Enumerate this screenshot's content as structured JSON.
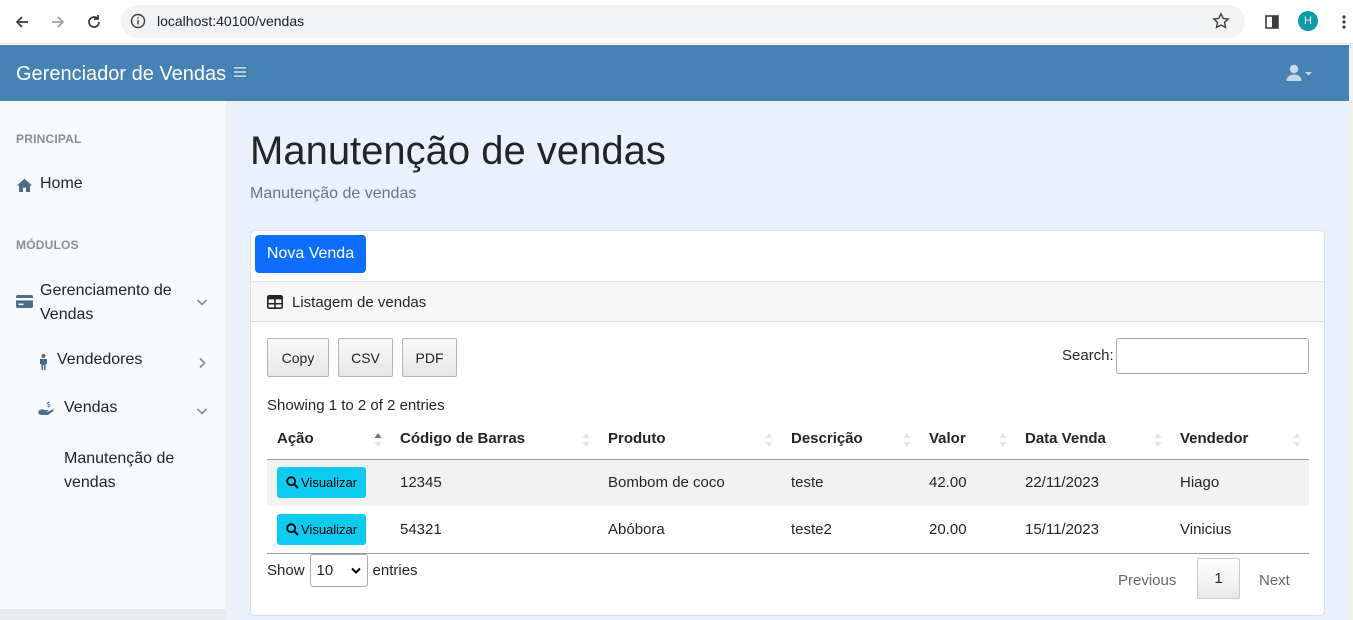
{
  "browser": {
    "url": "localhost:40100/vendas",
    "profile_initial": "H"
  },
  "app": {
    "brand": "Gerenciador de Vendas"
  },
  "sidebar": {
    "heading_principal": "PRINCIPAL",
    "home_label": "Home",
    "heading_modulos": "MÓDULOS",
    "gerenciamento_label_line1": "Gerenciamento de",
    "gerenciamento_label_line2": "Vendas",
    "vendedores_label": "Vendedores",
    "vendas_label": "Vendas",
    "manutencao_label_line1": "Manutenção de",
    "manutencao_label_line2": "vendas"
  },
  "page": {
    "title": "Manutenção de vendas",
    "subtitle": "Manutenção de vendas"
  },
  "card": {
    "new_button": "Nova Venda",
    "header": "Listagem de vendas",
    "buttons": [
      "Copy",
      "CSV",
      "PDF"
    ],
    "search_label": "Search:",
    "search_value": "",
    "info": "Showing 1 to 2 of 2 entries",
    "columns": [
      "Ação",
      "Código de Barras",
      "Produto",
      "Descrição",
      "Valor",
      "Data Venda",
      "Vendedor"
    ],
    "rows": [
      {
        "action": "Visualizar",
        "barcode": "12345",
        "product": "Bombom de coco",
        "description": "teste",
        "value": "42.00",
        "date": "22/11/2023",
        "seller": "Hiago"
      },
      {
        "action": "Visualizar",
        "barcode": "54321",
        "product": "Abóbora",
        "description": "teste2",
        "value": "20.00",
        "date": "15/11/2023",
        "seller": "Vinicius"
      }
    ],
    "length_prefix": "Show",
    "length_value": "10",
    "length_suffix": "entries",
    "pager_previous": "Previous",
    "pager_current": "1",
    "pager_next": "Next"
  },
  "colors": {
    "navbar": "#4682b4",
    "primary": "#0d6efd",
    "info": "#0dcaf0"
  }
}
